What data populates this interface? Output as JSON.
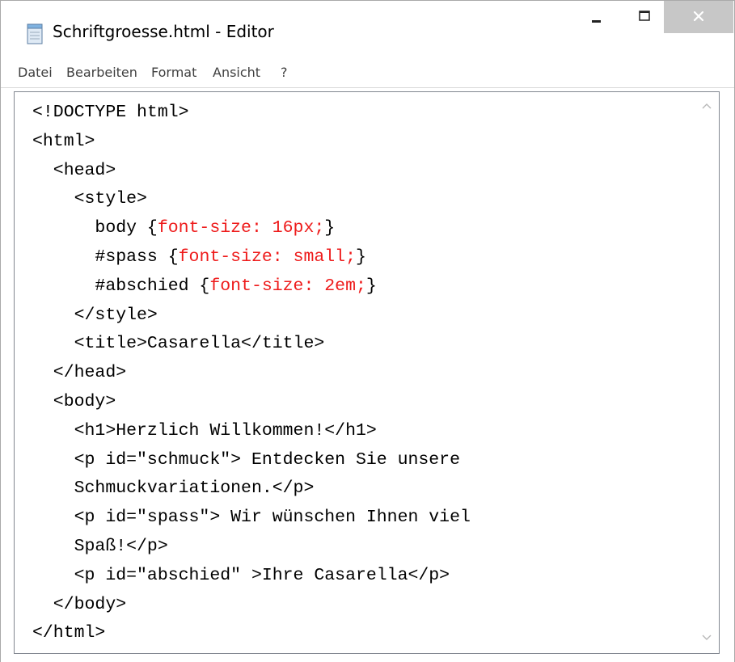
{
  "window": {
    "title": "Schriftgroesse.html - Editor",
    "icon": "notepad-icon",
    "controls": {
      "minimize": "minimize-icon",
      "maximize": "maximize-icon",
      "close": "close-icon"
    }
  },
  "menu": {
    "items": [
      {
        "label": "Datei"
      },
      {
        "label": "Bearbeiten"
      },
      {
        "label": "Format"
      },
      {
        "label": "Ansicht"
      },
      {
        "label": "?"
      }
    ]
  },
  "editor": {
    "lines": [
      {
        "segments": [
          {
            "text": "<!DOCTYPE html>"
          }
        ]
      },
      {
        "segments": [
          {
            "text": "<html>"
          }
        ]
      },
      {
        "segments": [
          {
            "text": "  <head>"
          }
        ]
      },
      {
        "segments": [
          {
            "text": "    <style>"
          }
        ]
      },
      {
        "segments": [
          {
            "text": "      body {"
          },
          {
            "text": "font-size: 16px;",
            "highlight": true
          },
          {
            "text": "}"
          }
        ]
      },
      {
        "segments": [
          {
            "text": "      #spass {"
          },
          {
            "text": "font-size: small;",
            "highlight": true
          },
          {
            "text": "}"
          }
        ]
      },
      {
        "segments": [
          {
            "text": "      #abschied {"
          },
          {
            "text": "font-size: 2em;",
            "highlight": true
          },
          {
            "text": "}"
          }
        ]
      },
      {
        "segments": [
          {
            "text": "    </style>"
          }
        ]
      },
      {
        "segments": [
          {
            "text": "    <title>Casarella</title>"
          }
        ]
      },
      {
        "segments": [
          {
            "text": "  </head>"
          }
        ]
      },
      {
        "segments": [
          {
            "text": "  <body>"
          }
        ]
      },
      {
        "segments": [
          {
            "text": "    <h1>Herzlich Willkommen!</h1>"
          }
        ]
      },
      {
        "segments": [
          {
            "text": "    <p id=\"schmuck\"> Entdecken Sie unsere"
          }
        ]
      },
      {
        "segments": [
          {
            "text": "    Schmuckvariationen.</p>"
          }
        ]
      },
      {
        "segments": [
          {
            "text": "    <p id=\"spass\"> Wir wünschen Ihnen viel"
          }
        ]
      },
      {
        "segments": [
          {
            "text": "    Spaß!</p>"
          }
        ]
      },
      {
        "segments": [
          {
            "text": "    <p id=\"abschied\" >Ihre Casarella</p>"
          }
        ]
      },
      {
        "segments": [
          {
            "text": "  </body>"
          }
        ]
      },
      {
        "segments": [
          {
            "text": "</html>"
          }
        ]
      }
    ]
  },
  "colors": {
    "highlight": "#ee1b1b",
    "close_button_bg": "#c7c7c7"
  }
}
